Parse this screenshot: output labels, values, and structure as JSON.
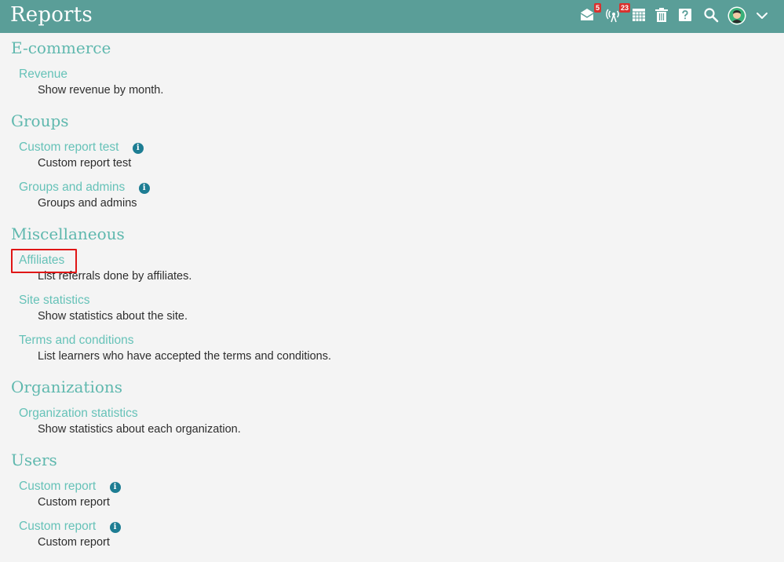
{
  "header": {
    "title": "Reports",
    "messages_badge": "5",
    "notifications_badge": "23",
    "icons": [
      "mail-icon",
      "broadcast-icon",
      "calendar-grid-icon",
      "trash-icon",
      "help-icon",
      "search-icon",
      "avatar",
      "chevron-down-icon"
    ]
  },
  "colors": {
    "header_bg": "#5a9e98",
    "category": "#5fb8ae",
    "link": "#66c2b8",
    "info_icon": "#1d7d93",
    "badge": "#d9322f",
    "highlight_box": "#e01616"
  },
  "sections": {
    "ecommerce": {
      "title": "E-commerce",
      "revenue": {
        "label": "Revenue",
        "description": "Show revenue by month."
      }
    },
    "groups": {
      "title": "Groups",
      "custom_report_test": {
        "label": "Custom report test",
        "description": "Custom report test"
      },
      "groups_and_admins": {
        "label": "Groups and admins",
        "description": "Groups and admins"
      }
    },
    "misc": {
      "title": "Miscellaneous",
      "affiliates": {
        "label": "Affiliates",
        "description": "List referrals done by affiliates."
      },
      "site_statistics": {
        "label": "Site statistics",
        "description": "Show statistics about the site."
      },
      "terms": {
        "label": "Terms and conditions",
        "description": "List learners who have accepted the terms and conditions."
      }
    },
    "organizations": {
      "title": "Organizations",
      "org_statistics": {
        "label": "Organization statistics",
        "description": "Show statistics about each organization."
      }
    },
    "users": {
      "title": "Users",
      "custom_report_1": {
        "label": "Custom report",
        "description": "Custom report"
      },
      "custom_report_2": {
        "label": "Custom report",
        "description": "Custom report"
      }
    }
  },
  "info_glyph": "i"
}
